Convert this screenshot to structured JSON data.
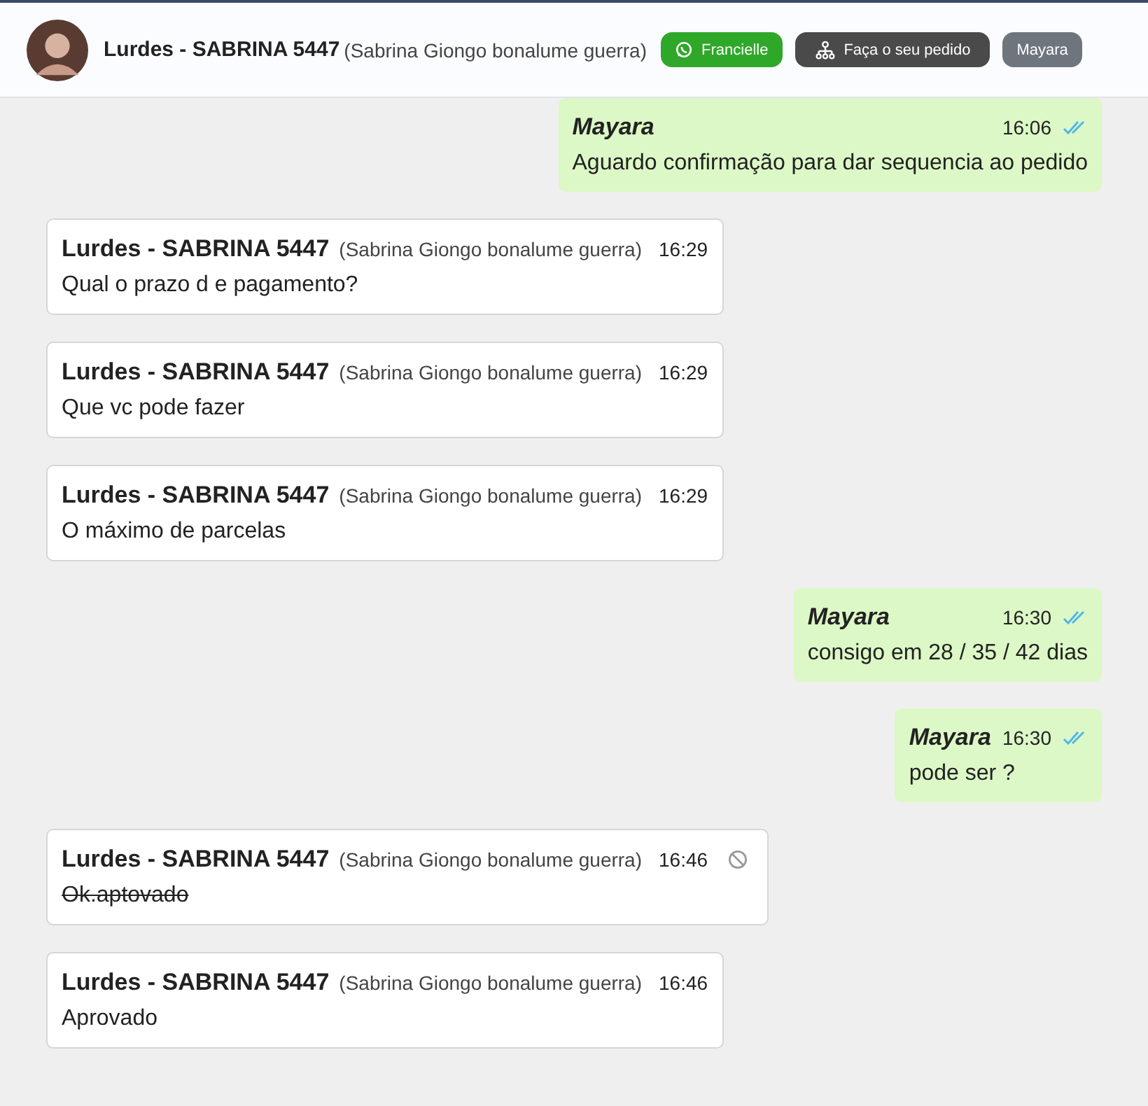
{
  "header": {
    "contact_name": "Lurdes - SABRINA 5447",
    "contact_subtitle": "(Sabrina Giongo bonalume guerra)",
    "buttons": [
      {
        "label": "Francielle",
        "kind": "whatsapp"
      },
      {
        "label": "Faça o seu pedido",
        "kind": "order"
      },
      {
        "label": "Mayara",
        "kind": "plain"
      }
    ]
  },
  "messages": [
    {
      "kind": "outgoing",
      "sender": "Mayara",
      "time": "16:06",
      "text": "Aguardo confirmação para dar sequencia ao pedido",
      "read": true
    },
    {
      "kind": "incoming",
      "sender": "Lurdes - SABRINA 5447",
      "sender_detail": "(Sabrina Giongo bonalume guerra)",
      "time": "16:29",
      "text": "Qual o prazo d e pagamento?",
      "deleted": false
    },
    {
      "kind": "incoming",
      "sender": "Lurdes - SABRINA 5447",
      "sender_detail": "(Sabrina Giongo bonalume guerra)",
      "time": "16:29",
      "text": "Que vc pode fazer",
      "deleted": false
    },
    {
      "kind": "incoming",
      "sender": "Lurdes - SABRINA 5447",
      "sender_detail": "(Sabrina Giongo bonalume guerra)",
      "time": "16:29",
      "text": "O máximo de parcelas",
      "deleted": false
    },
    {
      "kind": "outgoing",
      "sender": "Mayara",
      "time": "16:30",
      "text": "consigo em 28 / 35 / 42 dias",
      "read": true
    },
    {
      "kind": "outgoing",
      "sender": "Mayara",
      "time": "16:30",
      "text": "pode ser ?",
      "read": true
    },
    {
      "kind": "incoming",
      "sender": "Lurdes - SABRINA 5447",
      "sender_detail": "(Sabrina Giongo bonalume guerra)",
      "time": "16:46",
      "text": "Ok.aptovado",
      "deleted": true
    },
    {
      "kind": "incoming",
      "sender": "Lurdes - SABRINA 5447",
      "sender_detail": "(Sabrina Giongo bonalume guerra)",
      "time": "16:46",
      "text": "Aprovado",
      "deleted": false
    }
  ]
}
